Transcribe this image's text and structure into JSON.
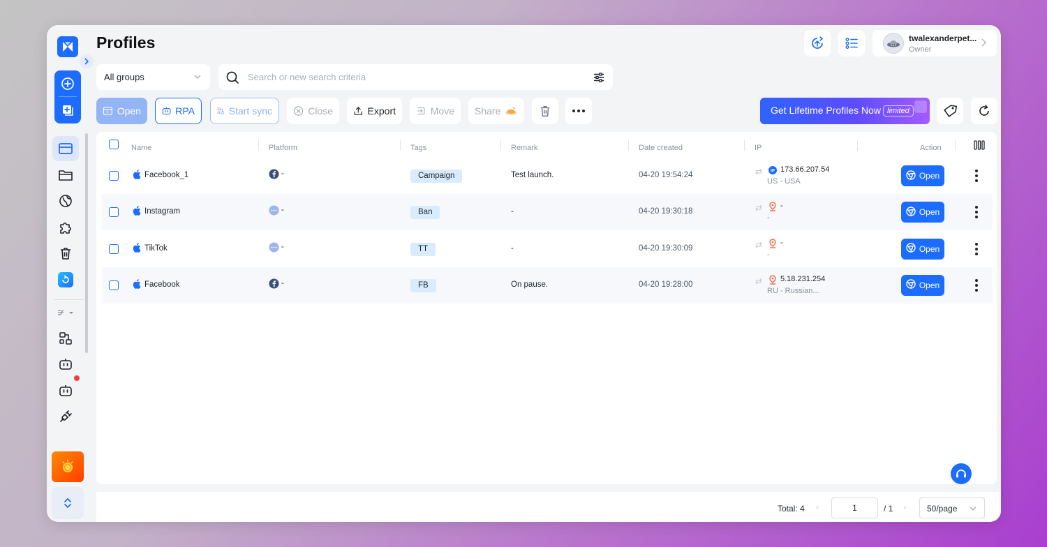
{
  "header": {
    "title": "Profiles",
    "user": {
      "name": "twalexanderpet...",
      "role": "Owner"
    }
  },
  "filters": {
    "group": "All groups",
    "search_placeholder": "Search or new search criteria"
  },
  "toolbar": {
    "open": "Open",
    "rpa": "RPA",
    "start_sync": "Start sync",
    "close": "Close",
    "export": "Export",
    "move": "Move",
    "share": "Share",
    "banner_text": "Get Lifetime Profiles Now",
    "banner_badge": "limited"
  },
  "table": {
    "columns": {
      "name": "Name",
      "platform": "Platform",
      "tags": "Tags",
      "remark": "Remark",
      "date_created": "Date created",
      "ip": "IP",
      "action": "Action"
    },
    "open_label": "Open",
    "rows": [
      {
        "name": "Facebook_1",
        "platform_icon": "facebook-icon",
        "platform": "-",
        "tag": "Campaign",
        "remark": "Test launch.",
        "date": "04-20 19:54:24",
        "ip_icon": "ip-badge-icon",
        "ip": "173.66.207.54",
        "location": "US - USA"
      },
      {
        "name": "Instagram",
        "platform_icon": "more-circle-icon",
        "platform": "-",
        "tag": "Ban",
        "remark": "-",
        "date": "04-20 19:30:18",
        "ip_icon": "location-pin-icon",
        "ip": "-",
        "location": "-"
      },
      {
        "name": "TikTok",
        "platform_icon": "more-circle-icon",
        "platform": "-",
        "tag": "TT",
        "remark": "-",
        "date": "04-20 19:30:09",
        "ip_icon": "location-pin-icon",
        "ip": "-",
        "location": "-"
      },
      {
        "name": "Facebook",
        "platform_icon": "facebook-icon",
        "platform": "-",
        "tag": "FB",
        "remark": "On pause.",
        "date": "04-20 19:28:00",
        "ip_icon": "location-pin-icon",
        "ip": "5.18.231.254",
        "location": "RU - Russian..."
      }
    ]
  },
  "pagination": {
    "total": "Total: 4",
    "page": "1",
    "of": "/ 1",
    "page_size": "50/page"
  },
  "colors": {
    "accent": "#1b6cff",
    "tag_bg": "#d9ecfe",
    "danger": "#f53f3f",
    "ip_pin": "#f0714f"
  }
}
